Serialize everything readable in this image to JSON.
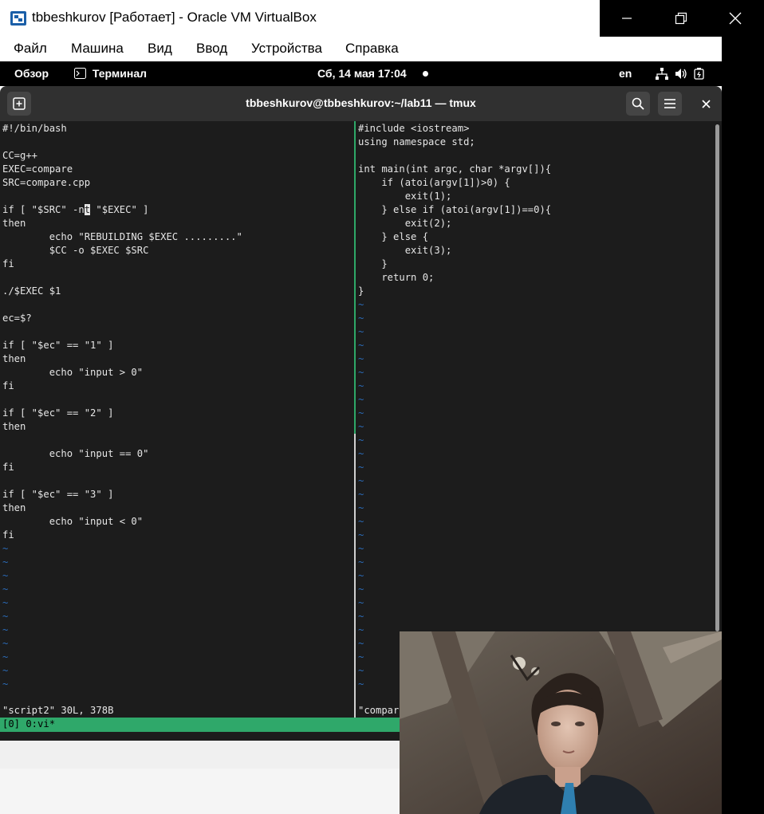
{
  "window": {
    "title": "tbbeshkurov [Работает] - Oracle VM VirtualBox",
    "icon": "virtualbox-icon",
    "controls": [
      "minimize-icon",
      "restore-icon",
      "close-icon"
    ]
  },
  "menu": [
    "Файл",
    "Машина",
    "Вид",
    "Ввод",
    "Устройства",
    "Справка"
  ],
  "topbar": {
    "overview": "Обзор",
    "app_name": "Терминал",
    "app_icon": "terminal-icon",
    "datetime": "Сб, 14 мая  17:04",
    "keyboard": "en",
    "status_icons": [
      "network-icon",
      "volume-icon",
      "battery-icon"
    ]
  },
  "terminal": {
    "title": "tbbeshkurov@tbbeshkurov:~/lab11 — tmux",
    "new_tab_icon": "new-tab-icon",
    "search_icon": "search-icon",
    "menu_icon": "hamburger-menu-icon",
    "close_icon": "close-icon"
  },
  "left_pane": {
    "lines": [
      "#!/bin/bash",
      "",
      "CC=g++",
      "EXEC=compare",
      "SRC=compare.cpp",
      "",
      "if [ \"$SRC\" -nt \"$EXEC\" ]",
      "then",
      "        echo \"REBUILDING $EXEC .........\"",
      "        $CC -o $EXEC $SRC",
      "fi",
      "",
      "./$EXEC $1",
      "",
      "ec=$?",
      "",
      "if [ \"$ec\" == \"1\" ]",
      "then",
      "        echo \"input > 0\"",
      "fi",
      "",
      "if [ \"$ec\" == \"2\" ]",
      "then",
      "",
      "        echo \"input == 0\"",
      "fi",
      "",
      "if [ \"$ec\" == \"3\" ]",
      "then",
      "        echo \"input < 0\"",
      "fi"
    ],
    "cursor": {
      "line": 6,
      "col": 14,
      "before": "if [ \"$SRC\" -n",
      "char": "t",
      "after": " \"$EXEC\" ]"
    },
    "status": "\"script2\" 30L, 378B"
  },
  "right_pane": {
    "lines": [
      "#include <iostream>",
      "using namespace std;",
      "",
      "int main(int argc, char *argv[]){",
      "    if (atoi(argv[1])>0) {",
      "        exit(1);",
      "    } else if (atoi(argv[1])==0){",
      "        exit(2);",
      "    } else {",
      "        exit(3);",
      "    }",
      "    return 0;",
      "}"
    ],
    "status": "\"compar"
  },
  "tmux_status": "[0] 0:vi*",
  "colors": {
    "terminal_bg": "#1c1c1c",
    "header_bg": "#303030",
    "tmux_green": "#2fa86a",
    "tilde_blue": "#2b6bb8"
  }
}
